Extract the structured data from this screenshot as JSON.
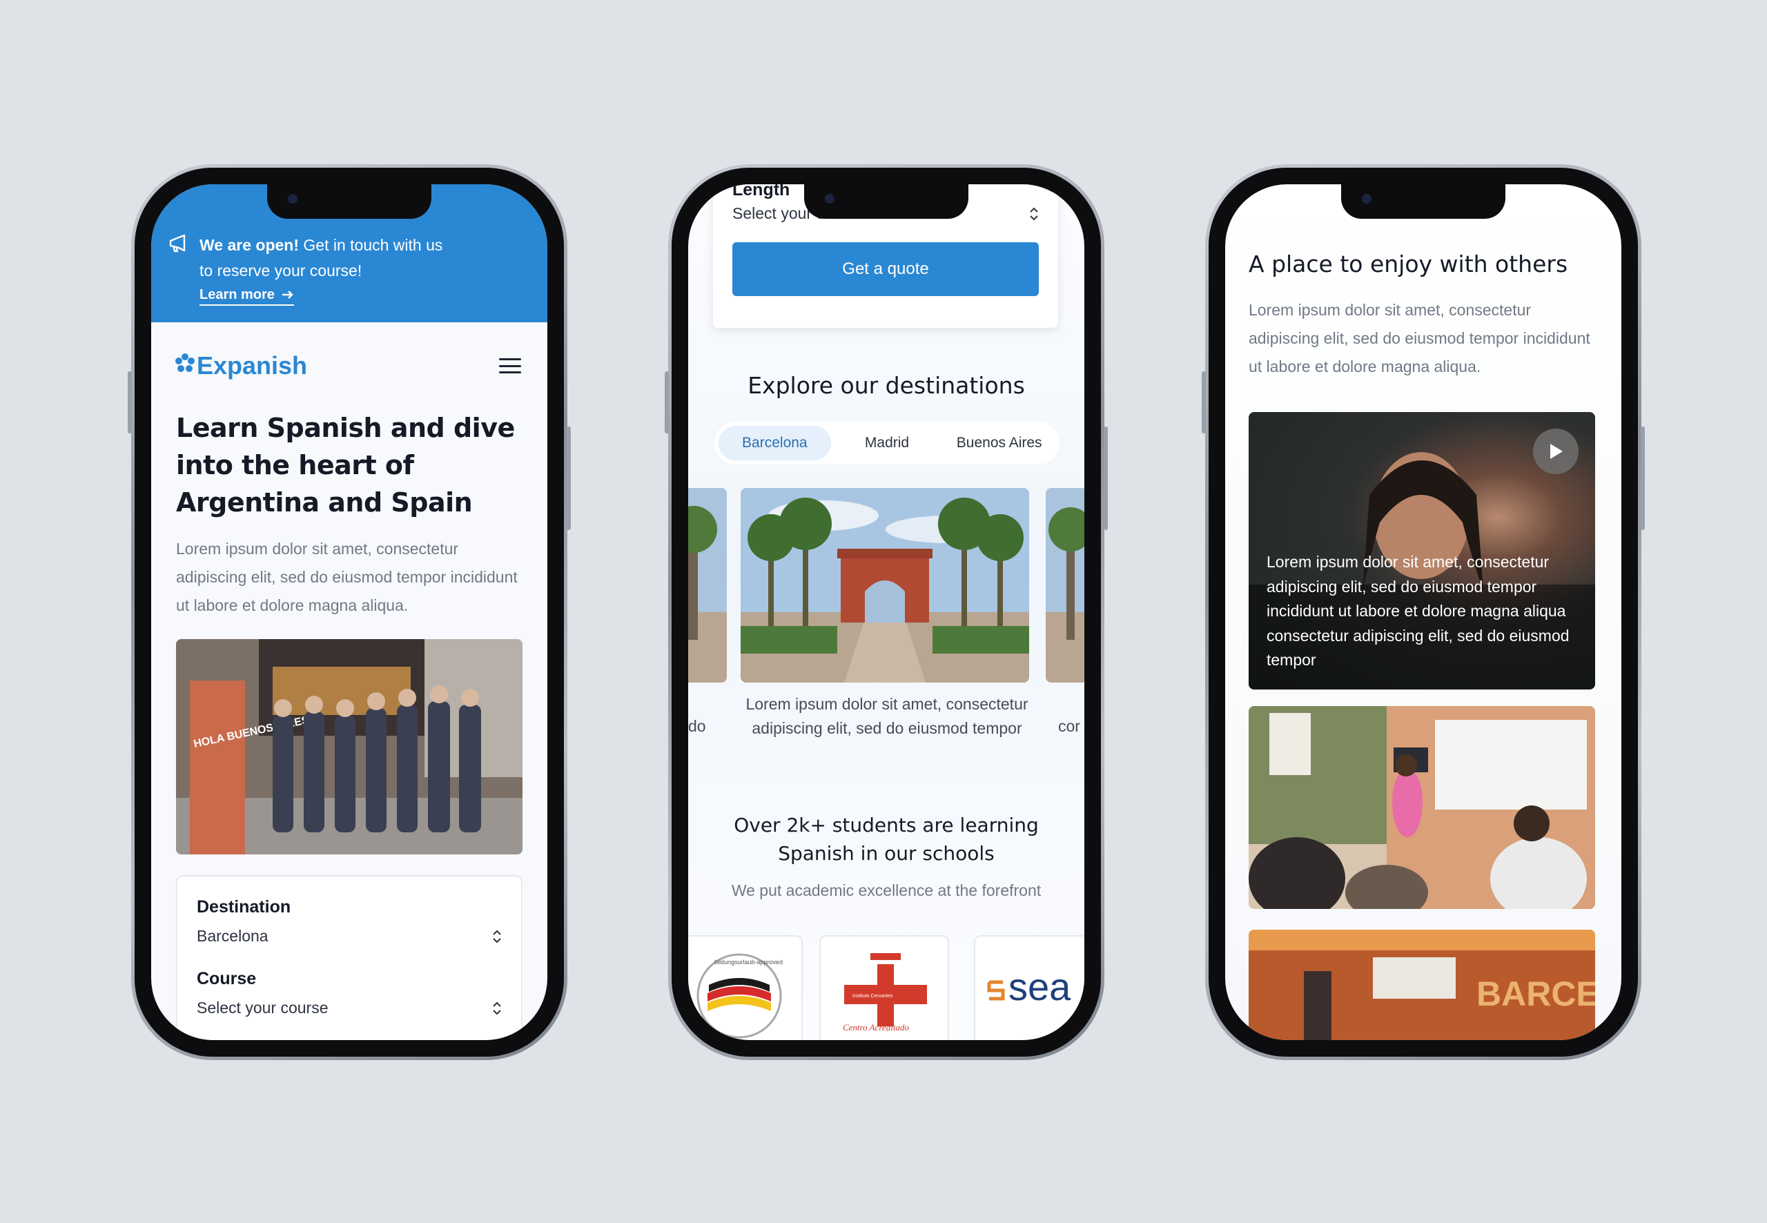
{
  "phone1": {
    "banner": {
      "bold": "We are open!",
      "text_line1": " Get in touch with us",
      "text_line2": "to reserve your course!",
      "link": "Learn more"
    },
    "logo": "Expanish",
    "hero_title": "Learn Spanish and dive into the heart of Argentina and Spain",
    "hero_paragraph": "Lorem ipsum dolor sit amet, consectetur adipiscing elit, sed do eiusmod tempor incididunt ut labore et dolore magna aliqua.",
    "hero_photo_sign": "HOLA BUENOS AIRES",
    "form": {
      "destination_label": "Destination",
      "destination_value": "Barcelona",
      "course_label": "Course",
      "course_value": "Select your course"
    }
  },
  "phone2": {
    "quote_card": {
      "length_label": "Length",
      "length_value": "Select your course",
      "button": "Get a quote"
    },
    "destinations_title": "Explore our destinations",
    "tabs": [
      "Barcelona",
      "Madrid",
      "Buenos Aires"
    ],
    "active_tab": "Barcelona",
    "card_caption": "Lorem ipsum dolor sit amet, consectetur adipiscing elit, sed do eiusmod tempor",
    "left_caption_fragment": "do",
    "right_caption_fragment": "cor",
    "students_title_line1": "Over 2k+ students are learning",
    "students_title_line2": "Spanish in our schools",
    "students_subtitle": "We put academic excellence at the forefront",
    "badges": {
      "badge1_text": "bildungsurlaub-approved",
      "badge2_text": "Centro Acreditado",
      "badge2_small": "Instituto Cervantes",
      "badge3_text": "sea"
    }
  },
  "phone3": {
    "title": "A place to enjoy with others",
    "paragraph": "Lorem ipsum dolor sit amet, consectetur adipiscing elit, sed do eiusmod tempor incididunt ut labore et dolore magna aliqua.",
    "video_text": "Lorem ipsum dolor sit amet, consectetur adipiscing elit, sed do eiusmod tempor incididunt ut labore et dolore magna aliqua consectetur adipiscing elit, sed do eiusmod tempor",
    "bar_sign": "BARCELO"
  },
  "colors": {
    "brand_blue": "#2a87d3",
    "background": "#dfe3e8",
    "active_tab_bg": "#e5f0fb"
  },
  "icons": [
    "megaphone-icon",
    "arrow-right-icon",
    "logo-flower-icon",
    "hamburger-icon",
    "chevron-updown-icon",
    "play-icon"
  ]
}
